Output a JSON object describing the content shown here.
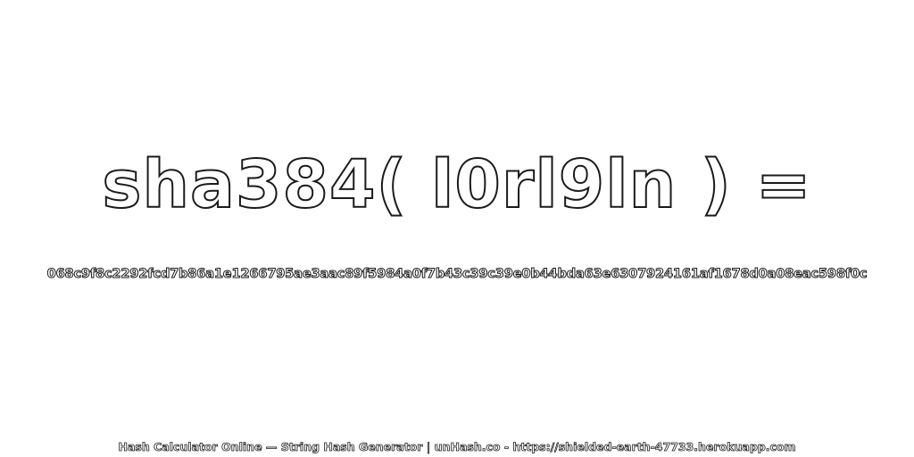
{
  "headline": "sha384( l0rl9ln ) =",
  "hash_value": "068c9f8c2292fcd7b86a1e1266795ae3aac89f5984a0f7b43c39c39e0b44bda63e6307924161af1678d0a08eac598f0c",
  "footer": "Hash Calculator Online — String Hash Generator | unHash.co - https://shielded-earth-47733.herokuapp.com"
}
